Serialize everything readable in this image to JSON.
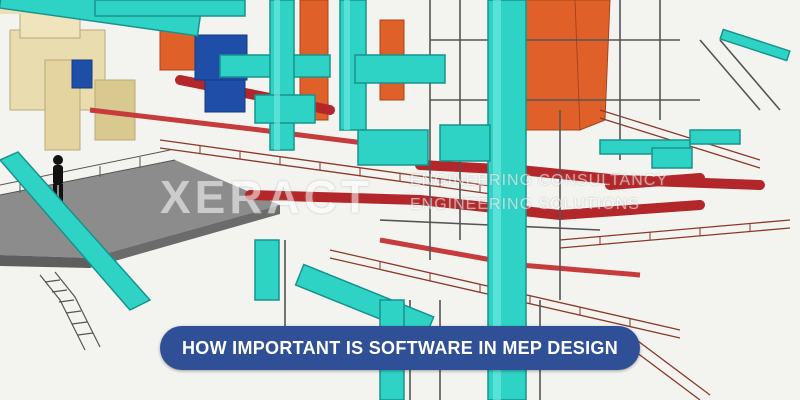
{
  "image": {
    "alt": "Industrial 3D model with teal ducts and pipes, red pipes and steel walkways"
  },
  "watermark": {
    "logo_text": "XERACT",
    "line1": "ENGINEERING CONSULTANCY",
    "line2": "ENGINEERING SOLUTIONS"
  },
  "banner": {
    "title": "HOW IMPORTANT IS SOFTWARE IN MEP DESIGN",
    "color": "#2f4f96"
  },
  "palette": {
    "teal": "#2fd3c6",
    "teal_dark": "#1a9a92",
    "red": "#c0392b",
    "orange": "#e0602a",
    "blue": "#1f4ea8",
    "beige": "#e8d9a8",
    "steel": "#7a7a7a"
  }
}
